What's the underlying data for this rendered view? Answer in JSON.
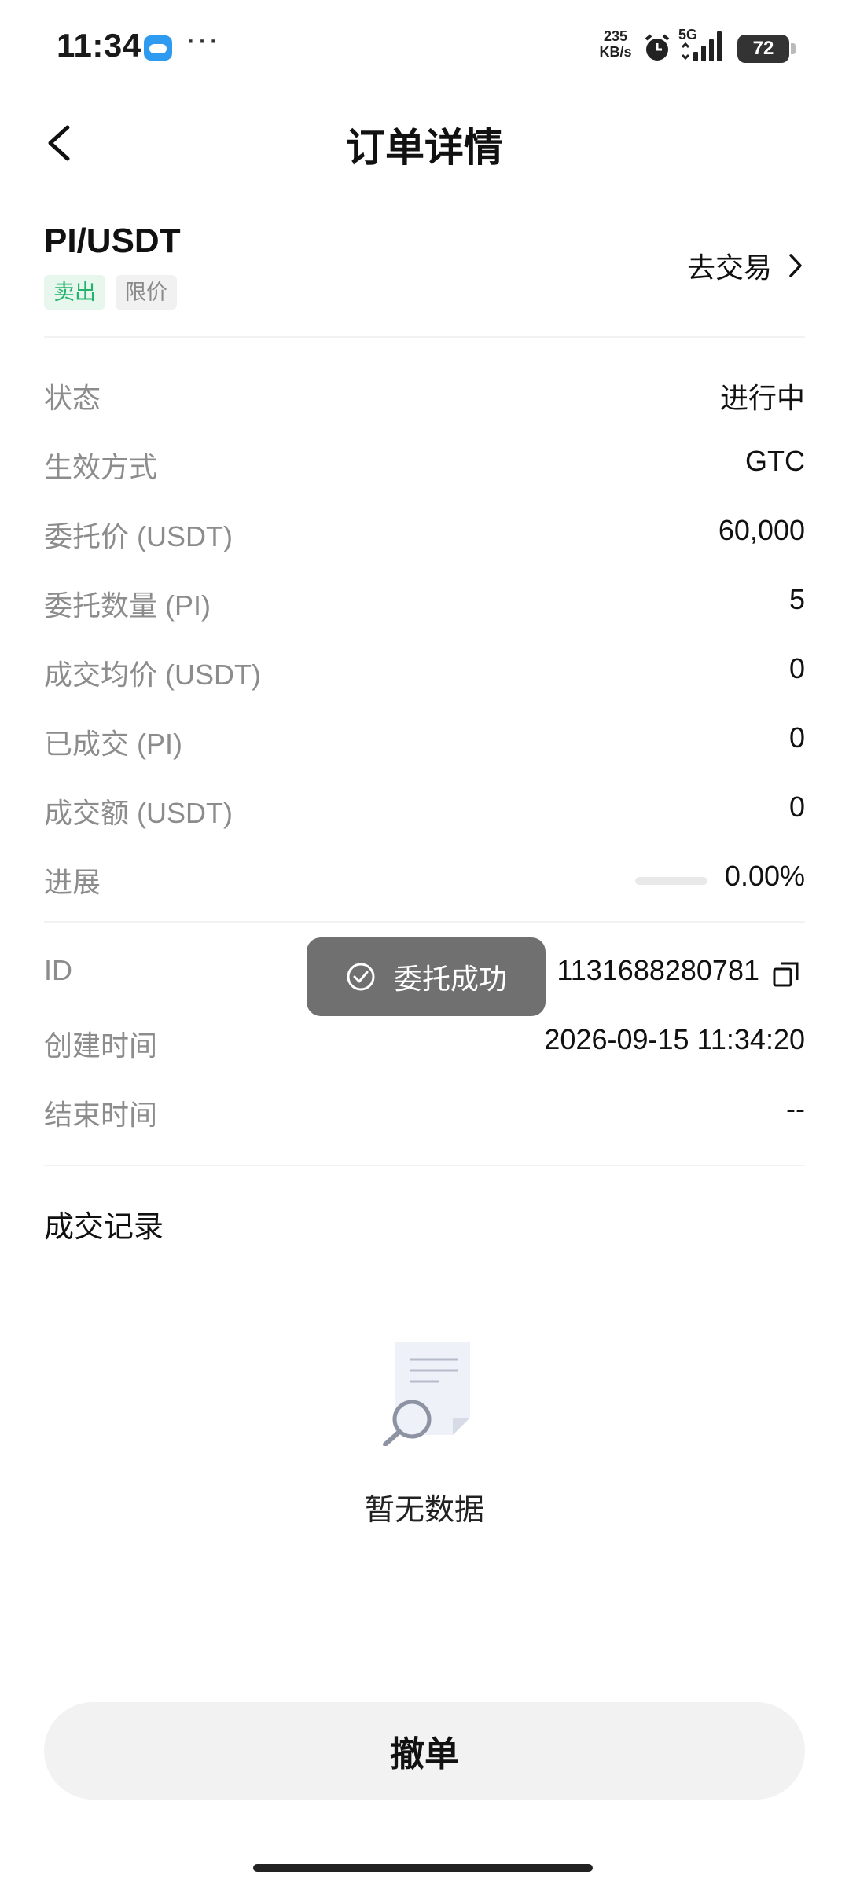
{
  "status_bar": {
    "time": "11:34",
    "notification_icons": [
      "cloud-app-icon",
      "more-dots-icon"
    ],
    "dots": "···",
    "net_speed": "235",
    "net_unit": "KB/s",
    "network": "5G",
    "battery": "72"
  },
  "header": {
    "title": "订单详情",
    "back_icon": "chevron-left-icon"
  },
  "order": {
    "pair": "PI/USDT",
    "side_tag": "卖出",
    "type_tag": "限价",
    "trade_link": "去交易",
    "side_color": "#24b36b"
  },
  "details": [
    {
      "label": "状态",
      "value": "进行中"
    },
    {
      "label": "生效方式",
      "value": "GTC"
    },
    {
      "label": "委托价 (USDT)",
      "value": "60,000"
    },
    {
      "label": "委托数量 (PI)",
      "value": "5"
    },
    {
      "label": "成交均价 (USDT)",
      "value": "0"
    },
    {
      "label": "已成交 (PI)",
      "value": "0"
    },
    {
      "label": "成交额 (USDT)",
      "value": "0"
    },
    {
      "label": "进展",
      "value": "0.00%",
      "progress_fraction": 0.0
    }
  ],
  "meta": [
    {
      "label": "ID",
      "value": "1131688280781"
    },
    {
      "label": "创建时间",
      "value": "2026-09-15 11:34:20"
    },
    {
      "label": "结束时间",
      "value": "--"
    }
  ],
  "records": {
    "title": "成交记录",
    "empty_text": "暂无数据"
  },
  "toast": {
    "text": "委托成功",
    "icon": "check-circle-icon"
  },
  "actions": {
    "cancel_label": "撤单"
  }
}
